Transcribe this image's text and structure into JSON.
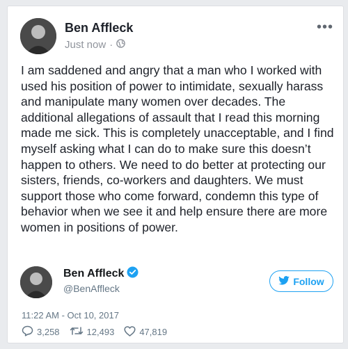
{
  "facebook_post": {
    "author_name": "Ben Affleck",
    "timestamp": "Just now",
    "separator": "·",
    "privacy_icon": "globe-icon",
    "more_icon": "more-options-icon",
    "body_text": "I am saddened and angry that a man who I worked with used his position of power to intimidate, sexually harass and manipulate many women over decades. The additional allegations of assault that I read this morning made me sick. This is completely unacceptable, and I find myself asking what I can do to make sure this doesn’t happen to others. We need to do better at protecting our sisters, friends, co-workers and daughters. We must support those who come forward, condemn this type of behavior when we see it and help ensure there are more women in positions of power."
  },
  "tweet": {
    "author_name": "Ben Affleck",
    "handle": "@BenAffleck",
    "verified_icon": "verified-badge-icon",
    "follow_label": "Follow",
    "time": "11:22 AM - Oct 10, 2017",
    "replies": "3,258",
    "retweets": "12,493",
    "likes": "47,819"
  },
  "colors": {
    "twitter_blue": "#1da1f2",
    "muted_gray": "#657786",
    "fb_text": "#1d2129"
  }
}
